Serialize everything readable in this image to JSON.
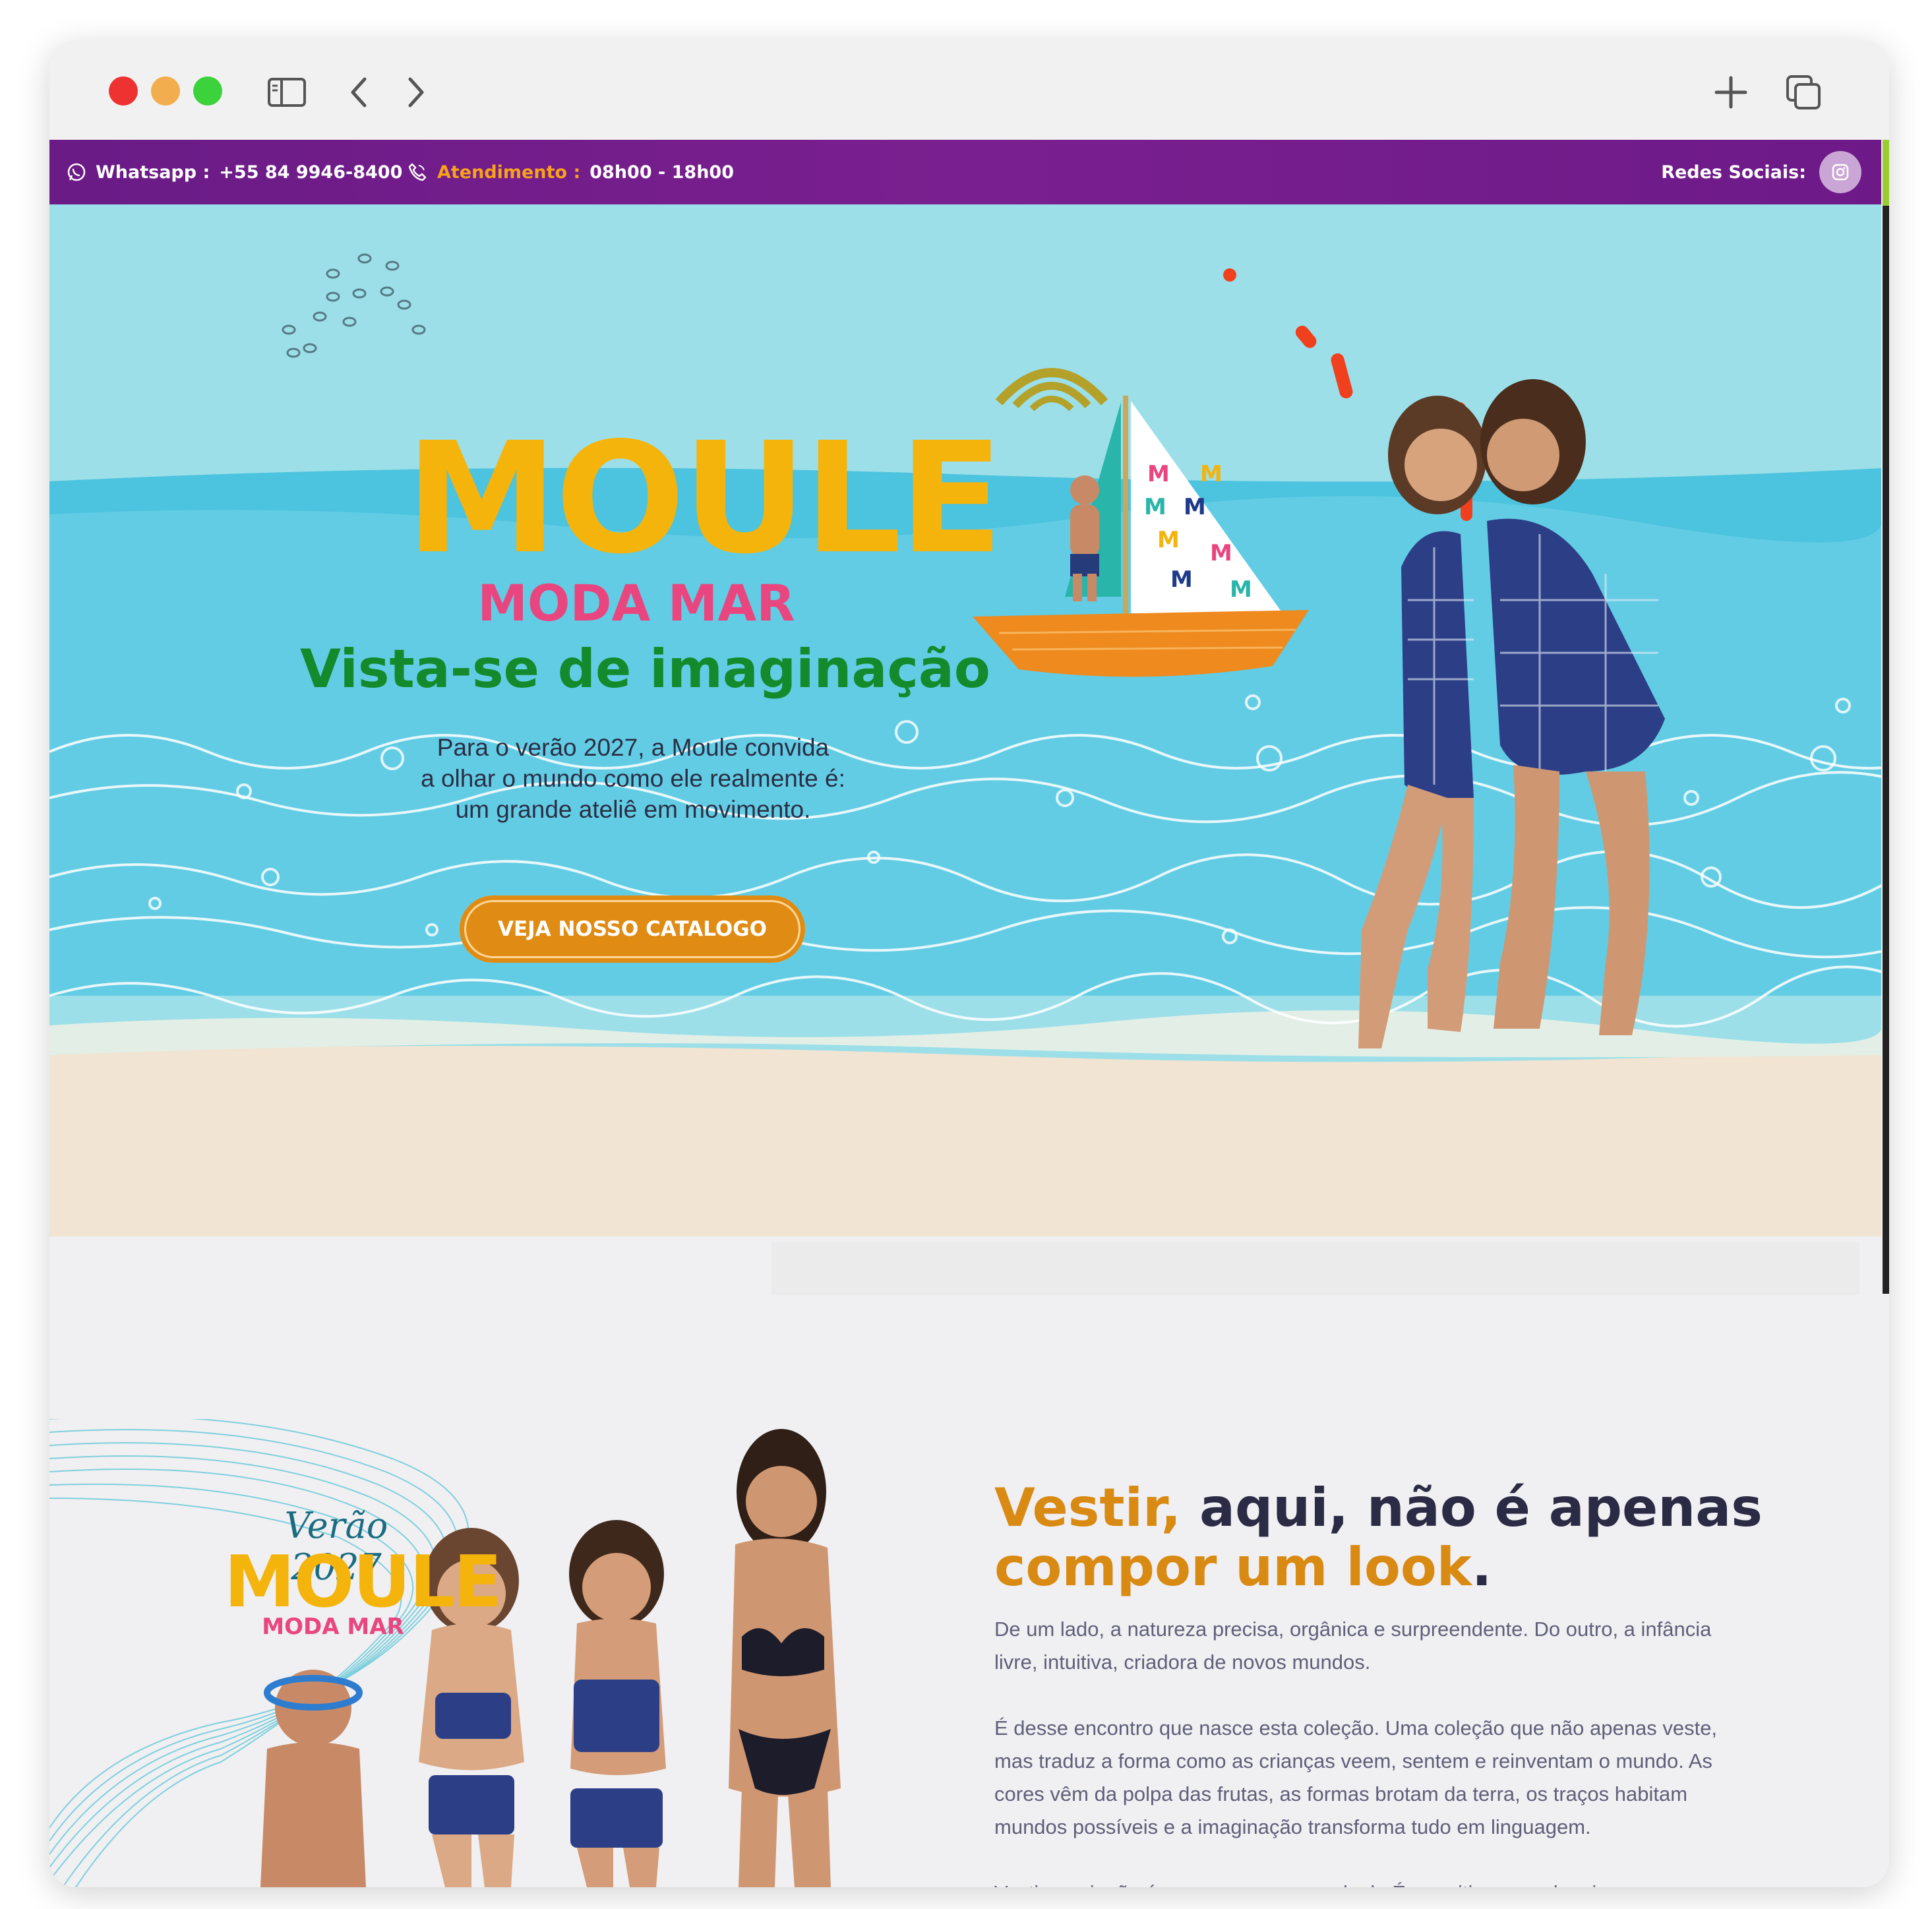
{
  "topbar": {
    "whatsapp_label": "Whatsapp :",
    "whatsapp_number": "+55 84 9946-8400",
    "hours_label": "Atendimento :",
    "hours_value": "08h00 - 18h00",
    "social_label": "Redes Sociais:"
  },
  "hero": {
    "brand": "MOULE",
    "brand_sub": "MODA MAR",
    "title": "Vista-se de imaginação",
    "text_lines": [
      "Para o verão 2027, a Moule convida",
      "a olhar o mundo como ele realmente é:",
      "um grande ateliê em movimento."
    ],
    "cta_label": "VEJA NOSSO CATALOGO"
  },
  "about": {
    "badge_verao": "Verão 2027",
    "badge_brand": "MOULE",
    "badge_sub": "MODA MAR",
    "title_gold_1": "Vestir,",
    "title_dark_1": " aqui, não é apenas",
    "title_gold_2": "compor um look",
    "title_dark_2": ".",
    "paragraph_1": "De um lado, a natureza precisa, orgânica e surpreendente. Do outro, a infância livre, intuitiva, criadora de novos mundos.",
    "paragraph_2": "É desse encontro que nasce esta coleção. Uma coleção que não apenas veste, mas traduz a forma como as crianças veem, sentem e reinventam o mundo. As cores vêm da polpa das frutas, as formas brotam da terra, os traços habitam mundos possíveis e a imaginação transforma tudo em linguagem.",
    "paragraph_3": "Vestir, aqui, não é apenas compor um look. É permitir que cada criança"
  },
  "colors": {
    "topbar": "#7a1f8f",
    "accent_orange": "#f7a21b",
    "brand_yellow": "#f4b40c",
    "brand_pink": "#e94680",
    "title_green": "#138a2b",
    "cta": "#e08c14",
    "sea": "#5cc9e3",
    "sand": "#f1e4d2"
  },
  "icons": [
    "whatsapp-icon",
    "phone-icon",
    "instagram-icon",
    "sidebar-icon",
    "back-icon",
    "forward-icon",
    "plus-icon",
    "tabs-icon"
  ]
}
